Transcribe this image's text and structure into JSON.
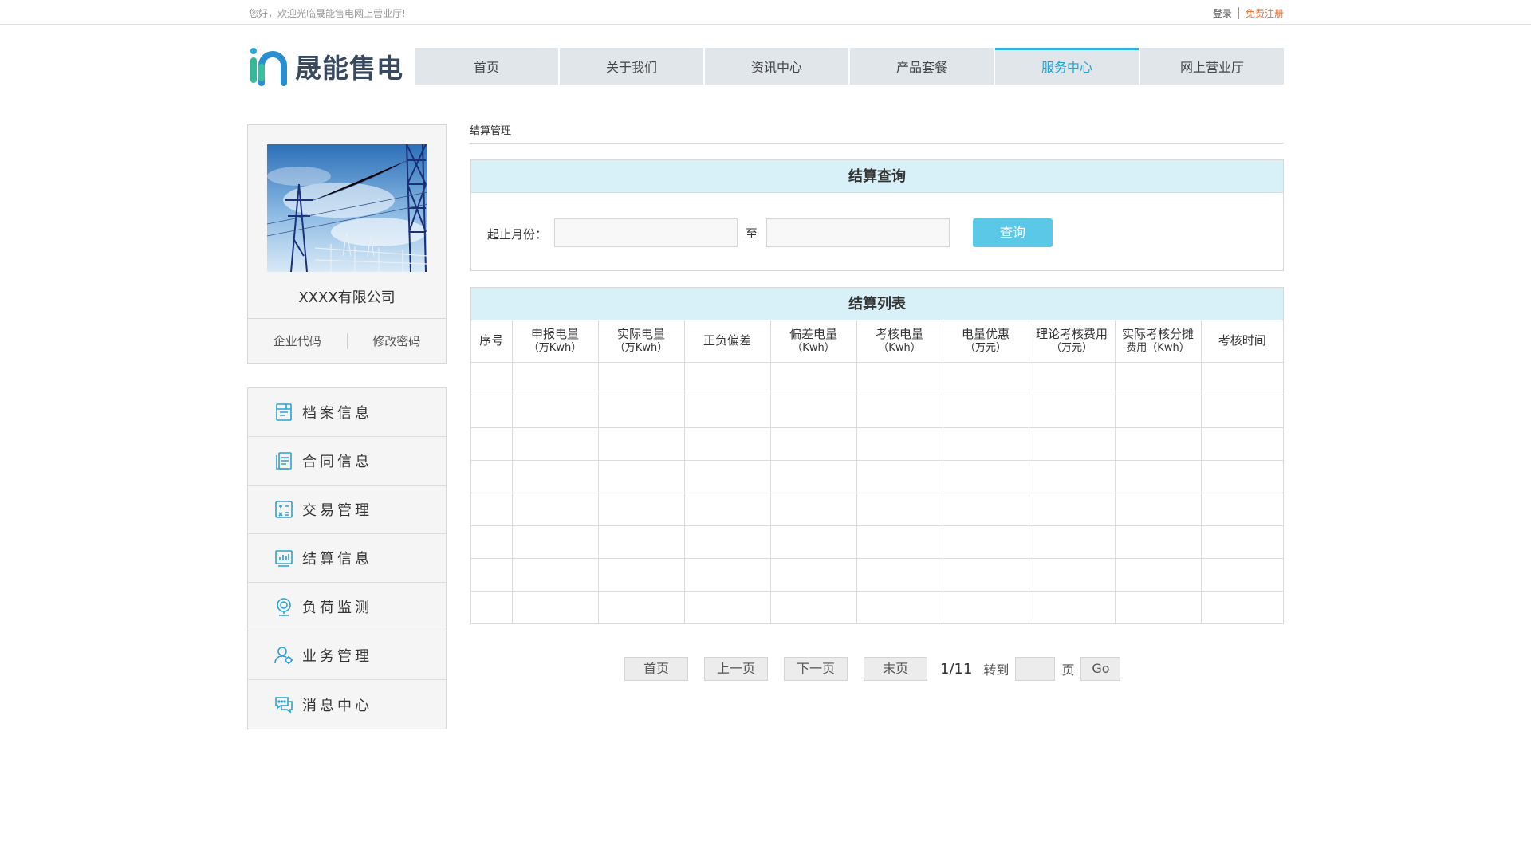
{
  "topbar": {
    "welcome": "您好，欢迎光临晟能售电网上营业厅!",
    "login": "登录",
    "register": "免费注册"
  },
  "header": {
    "brand": "晟能售电",
    "nav": [
      {
        "label": "首页",
        "active": false
      },
      {
        "label": "关于我们",
        "active": false
      },
      {
        "label": "资讯中心",
        "active": false
      },
      {
        "label": "产品套餐",
        "active": false
      },
      {
        "label": "服务中心",
        "active": true
      },
      {
        "label": "网上营业厅",
        "active": false
      }
    ],
    "accent_color": "#1aa5d8"
  },
  "sidebar": {
    "company_name": "XXXX有限公司",
    "actions": [
      "企业代码",
      "修改密码"
    ],
    "menu": [
      {
        "label": "档案信息",
        "icon": "archive-icon"
      },
      {
        "label": "合同信息",
        "icon": "contract-icon"
      },
      {
        "label": "交易管理",
        "icon": "calculator-icon"
      },
      {
        "label": "结算信息",
        "icon": "bar-chart-icon"
      },
      {
        "label": "负荷监测",
        "icon": "monitor-icon"
      },
      {
        "label": "业务管理",
        "icon": "user-gear-icon"
      },
      {
        "label": "消息中心",
        "icon": "message-icon"
      }
    ]
  },
  "main": {
    "breadcrumb": "结算管理",
    "query": {
      "title": "结算查询",
      "label": "起止月份：",
      "to": "至",
      "button": "查询"
    },
    "list": {
      "title": "结算列表",
      "headers": [
        {
          "l1": "序号",
          "l2": ""
        },
        {
          "l1": "申报电量",
          "l2": "（万Kwh）"
        },
        {
          "l1": "实际电量",
          "l2": "（万Kwh）"
        },
        {
          "l1": "正负偏差",
          "l2": ""
        },
        {
          "l1": "偏差电量",
          "l2": "（Kwh）"
        },
        {
          "l1": "考核电量",
          "l2": "（Kwh）"
        },
        {
          "l1": "电量优惠",
          "l2": "（万元）"
        },
        {
          "l1": "理论考核费用",
          "l2": "（万元）"
        },
        {
          "l1": "实际考核分摊",
          "l2": "费用（Kwh）"
        },
        {
          "l1": "考核时间",
          "l2": ""
        }
      ],
      "empty_rows": 8
    },
    "pager": {
      "first": "首页",
      "prev": "上一页",
      "next": "下一页",
      "last": "末页",
      "info": "1/11",
      "goto": "转到",
      "page": "页",
      "go": "Go"
    }
  }
}
